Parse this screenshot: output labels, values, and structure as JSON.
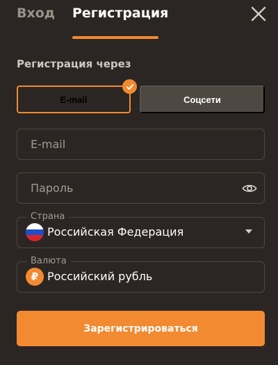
{
  "header": {
    "tab_login": "Вход",
    "tab_register": "Регистрация",
    "close_icon": "close-icon"
  },
  "form": {
    "section_label": "Регистрация через",
    "methods": {
      "email": "E-mail",
      "social": "Соцсети",
      "selected": "email"
    },
    "email_placeholder": "E-mail",
    "password_placeholder": "Пароль",
    "country_label": "Страна",
    "country_value": "Российская Федерация",
    "currency_label": "Валюта",
    "currency_symbol": "₽",
    "currency_value": "Российский рубль",
    "submit_label": "Зарегистрироваться"
  },
  "icons": [
    "close-icon",
    "checkmark-icon",
    "eye-icon",
    "russia-flag-icon",
    "ruble-coin-icon",
    "dropdown-caret-icon"
  ],
  "colors": {
    "background": "#2b2623",
    "accent": "#f28a31",
    "border": "#4e4843",
    "inactive_tab": "#9b928b",
    "secondary_button": "#4e4843"
  }
}
